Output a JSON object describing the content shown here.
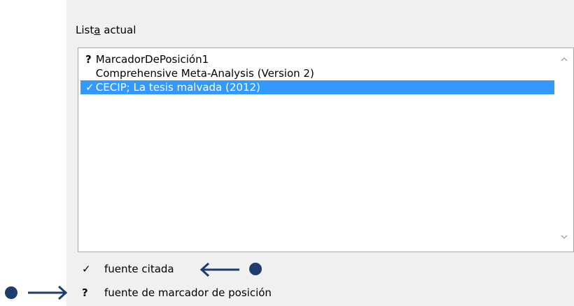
{
  "current_list": {
    "label_pre": "List",
    "label_accel": "a",
    "label_post": " actual",
    "items": [
      {
        "mark": "?",
        "text": "MarcadorDePosición1",
        "selected": false
      },
      {
        "mark": "",
        "text": "Comprehensive Meta-Analysis (Version 2)",
        "selected": false
      },
      {
        "mark": "✓",
        "text": "CECIP; La tesis malvada (2012)",
        "selected": true
      }
    ]
  },
  "legend": {
    "cited_mark": "✓",
    "cited_label": "fuente citada",
    "placeholder_mark": "?",
    "placeholder_label": "fuente de marcador de posición"
  },
  "colors": {
    "selection": "#3399ff",
    "annotation": "#1f3c6e",
    "panel_bg": "#f0f0f0"
  },
  "icons": {
    "scroll_up": "scroll-up-arrow-icon",
    "scroll_down": "scroll-down-arrow-icon",
    "annotation_arrow": "arrow-icon"
  }
}
